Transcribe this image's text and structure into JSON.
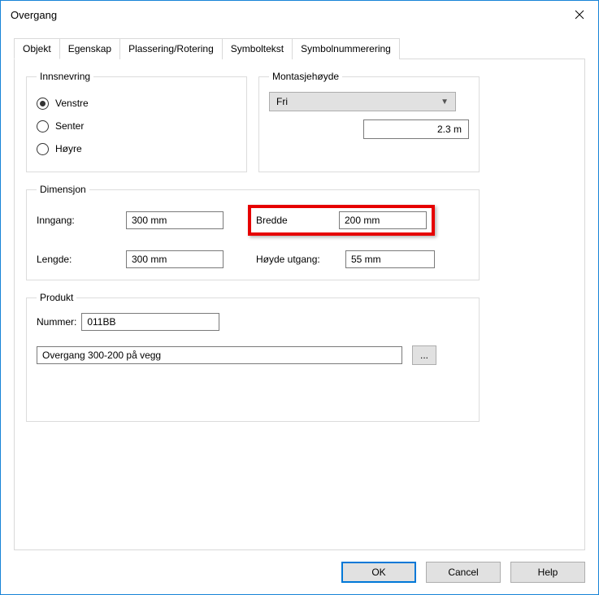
{
  "window": {
    "title": "Overgang"
  },
  "tabs": [
    "Objekt",
    "Egenskap",
    "Plassering/Rotering",
    "Symboltekst",
    "Symbolnummerering"
  ],
  "innsnevring": {
    "legend": "Innsnevring",
    "options": {
      "venstre": "Venstre",
      "senter": "Senter",
      "hoyre": "Høyre"
    }
  },
  "montasje": {
    "legend": "Montasjehøyde",
    "select_value": "Fri",
    "height_value": "2.3 m"
  },
  "dimensjon": {
    "legend": "Dimensjon",
    "inngang_label": "Inngang:",
    "inngang_value": "300 mm",
    "lengde_label": "Lengde:",
    "lengde_value": "300 mm",
    "bredde_label": "Bredde",
    "bredde_value": "200 mm",
    "hoyde_label": "Høyde utgang:",
    "hoyde_value": "55 mm"
  },
  "produkt": {
    "legend": "Produkt",
    "nummer_label": "Nummer:",
    "nummer_value": "011BB",
    "desc_value": "Overgang 300-200 på vegg",
    "browse_label": "..."
  },
  "buttons": {
    "ok": "OK",
    "cancel": "Cancel",
    "help": "Help"
  }
}
